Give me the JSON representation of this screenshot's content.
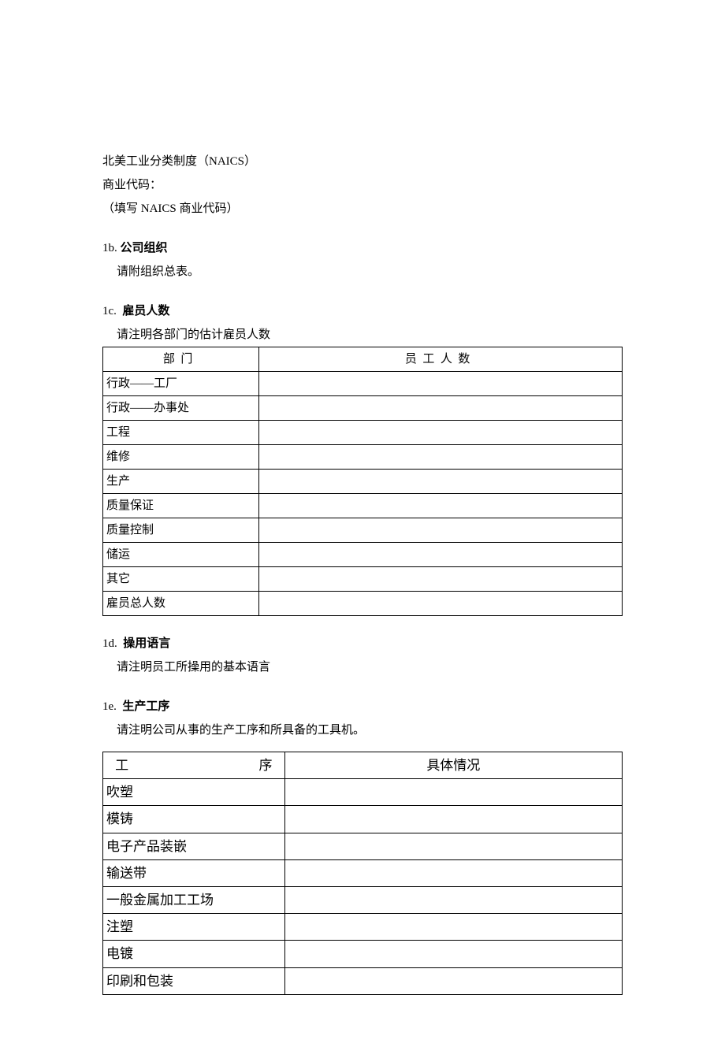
{
  "naics": {
    "l1": "北美工业分类制度（NAICS）",
    "l2": "商业代码：",
    "l3": "（填写 NAICS 商业代码）"
  },
  "s1b": {
    "num": "1b.",
    "title": "公司组织",
    "body": "请附组织总表。"
  },
  "s1c": {
    "num": "1c.",
    "title": "雇员人数",
    "body": "请注明各部门的估计雇员人数",
    "th1": "部门",
    "th2": "员工人数",
    "rows": [
      "行政——工厂",
      "行政——办事处",
      "工程",
      "维修",
      "生产",
      "质量保证",
      "质量控制",
      "储运",
      "其它",
      "雇员总人数"
    ]
  },
  "s1d": {
    "num": "1d.",
    "title": "操用语言",
    "body": "请注明员工所操用的基本语言"
  },
  "s1e": {
    "num": "1e.",
    "title": "生产工序",
    "body": "请注明公司从事的生产工序和所具备的工具机。",
    "th1": "工序",
    "th2": "具体情况",
    "rows": [
      "吹塑",
      "模铸",
      "电子产品装嵌",
      "输送带",
      "一般金属加工工场",
      "注塑",
      "电镀",
      "印刷和包装"
    ]
  }
}
